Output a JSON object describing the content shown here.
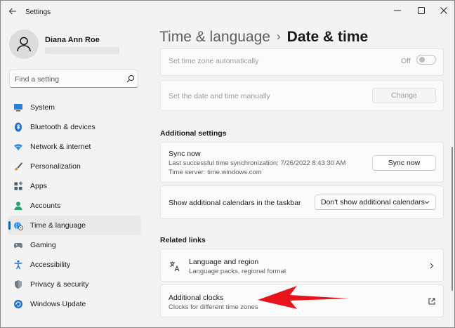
{
  "window": {
    "title": "Settings"
  },
  "user": {
    "name": "Diana Ann Roe"
  },
  "search": {
    "placeholder": "Find a setting"
  },
  "nav": [
    {
      "label": "System",
      "icon": "monitor-icon"
    },
    {
      "label": "Bluetooth & devices",
      "icon": "bluetooth-icon"
    },
    {
      "label": "Network & internet",
      "icon": "wifi-icon"
    },
    {
      "label": "Personalization",
      "icon": "brush-icon"
    },
    {
      "label": "Apps",
      "icon": "apps-icon"
    },
    {
      "label": "Accounts",
      "icon": "person-icon"
    },
    {
      "label": "Time & language",
      "icon": "globe-clock-icon",
      "active": true
    },
    {
      "label": "Gaming",
      "icon": "gamepad-icon"
    },
    {
      "label": "Accessibility",
      "icon": "accessibility-icon"
    },
    {
      "label": "Privacy & security",
      "icon": "shield-icon"
    },
    {
      "label": "Windows Update",
      "icon": "update-icon"
    }
  ],
  "breadcrumb": {
    "parent": "Time & language",
    "separator": "›",
    "current": "Date & time"
  },
  "settings": {
    "auto_timezone": {
      "label": "Set time zone automatically",
      "state": "Off"
    },
    "manual_time": {
      "label": "Set the date and time manually",
      "button": "Change"
    }
  },
  "additional": {
    "title": "Additional settings",
    "sync": {
      "title": "Sync now",
      "last": "Last successful time synchronization: 7/26/2022 8:43:30 AM",
      "server": "Time server: time.windows.com",
      "button": "Sync now"
    },
    "calendars": {
      "label": "Show additional calendars in the taskbar",
      "value": "Don't show additional calendars"
    }
  },
  "related": {
    "title": "Related links",
    "language": {
      "title": "Language and region",
      "sub": "Language packs, regional format"
    },
    "clocks": {
      "title": "Additional clocks",
      "sub": "Clocks for different time zones"
    }
  },
  "colors": {
    "accent": "#0067c0",
    "arrow": "#e8141c"
  }
}
